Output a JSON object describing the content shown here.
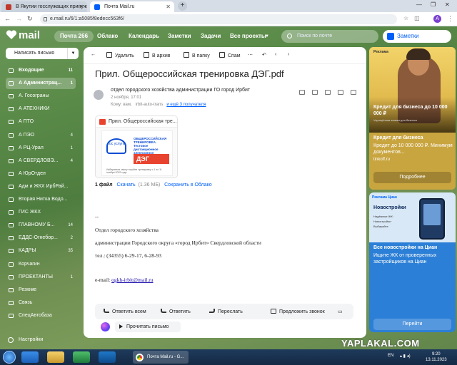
{
  "browser": {
    "tabs": [
      {
        "label": "В Якутии госслужащих принуж",
        "fav_color": "#c0392b"
      },
      {
        "label": "Почта Mail.ru",
        "fav_color": "#005ff9"
      }
    ],
    "url": "e.mail.ru/6/1:a5085f8edecc563f6/",
    "profile_initial": "А"
  },
  "topnav": {
    "logo": "mail",
    "mail_label": "Почта 266",
    "cloud": "Облако",
    "calendar": "Календарь",
    "notes": "Заметки",
    "tasks": "Задачи",
    "projects": "Все проекты",
    "search_placeholder": "Поиск по почте",
    "notes_button": "Заметки"
  },
  "sidebar": {
    "compose": "Написать письмо",
    "folders": [
      {
        "label": "Входящие",
        "count": "11",
        "bold": true
      },
      {
        "label": "А Администрац...",
        "count": "1",
        "bold": true,
        "selected": true
      },
      {
        "label": "А. Госограны",
        "count": ""
      },
      {
        "label": "А АТЕХНИКИ",
        "count": ""
      },
      {
        "label": "А ПТО",
        "count": ""
      },
      {
        "label": "А ПЭО",
        "count": "4"
      },
      {
        "label": "А РЦ-Урал",
        "count": "1"
      },
      {
        "label": "А СВЕРДЛОВЭ...",
        "count": "4"
      },
      {
        "label": "А ЮрОтдел",
        "count": ""
      },
      {
        "label": "Адм и ЖКХ ИрбРай...",
        "count": ""
      },
      {
        "label": "Вторая Нитка Водо...",
        "count": ""
      },
      {
        "label": "ГИС ЖКХ",
        "count": ""
      },
      {
        "label": "ГЛАВНОМУ Б...",
        "count": "14"
      },
      {
        "label": "ЕДДС-Огнебор...",
        "count": "2"
      },
      {
        "label": "КАДРЫ",
        "count": "35"
      },
      {
        "label": "Корчагин",
        "count": ""
      },
      {
        "label": "ПРОЕКТАНТЫ",
        "count": "1"
      },
      {
        "label": "Резюме",
        "count": ""
      },
      {
        "label": "Связь",
        "count": ""
      },
      {
        "label": "СпецАвтобаза",
        "count": ""
      }
    ],
    "settings": "Настройки"
  },
  "toolbar": {
    "delete": "Удалить",
    "archive": "В архив",
    "to_folder": "В папку",
    "spam": "Спам"
  },
  "message": {
    "subject": "Прил. Общероссийская тренировка ДЭГ.pdf",
    "sender": "отдел городского хозяйства администрации ГО город Ирбит",
    "date": "2 ноября, 17:01",
    "to_prefix": "Кому: вам,",
    "to_other": "irbit-auto-trans",
    "to_more": "и ещё 3 получателя",
    "attachment": {
      "name": "Прил. Общероссийская тре...",
      "gos_label": "гос услуги",
      "thumb_title": "ОБЩЕРОССИЙСКАЯ ТРЕНИРОВКА. Тестовое дистанционное электронное голосование",
      "thumb_deg": "ДЭГ",
      "thumb_small": "Избиратели смогут пройти тренировку с 1 по 11 ноября 2022 года"
    },
    "file_count": "1 файл",
    "download": "Скачать",
    "file_size": "(1.36 МБ)",
    "save_cloud": "Сохранить в Облако",
    "signature": {
      "dash": "--",
      "dept": "Отдел городского хозяйства",
      "admin": "администрации Городского округа «город Ирбит» Свердловской области",
      "phone": "тел.: (34355) 6-29-17, 6-28-93",
      "email_label": "e-mail:",
      "email": "ogkh-irbit@mail.ru"
    }
  },
  "reply": {
    "reply_all": "Ответить всем",
    "reply": "Ответить",
    "forward": "Переслать",
    "call": "Предложить звонок",
    "read_aloud": "Прочитать письмо"
  },
  "ads": {
    "ad1": {
      "brand": "Реклама",
      "big": "Кредит для бизнеса до 10 000 000 ₽",
      "small": "Упрощённая заявка для бизнеса",
      "headline": "Кредит для бизнеса",
      "desc": "Кредит до 10 000 000 ₽. Минимум документов...",
      "source": "tinkoff.ru",
      "button": "Подробнее"
    },
    "ad2": {
      "brand": "Реклама Циан",
      "title": "Новостройки",
      "pills": "Надёжные ЖК · Новостройки · Выбирайте",
      "headline": "Все новостройки на Циан",
      "desc": "Ищите ЖК от проверенных застройщиков на Циан",
      "button": "Перейти"
    }
  },
  "watermark": "YAPLAKAL.COM",
  "taskbar": {
    "chrome_label": "Почта Mail.ru - G...",
    "lang": "EN",
    "time": "9:20",
    "date": "13.11.2023"
  },
  "colors": {
    "accent": "#005ff9",
    "pdf_red": "#e8432e"
  }
}
